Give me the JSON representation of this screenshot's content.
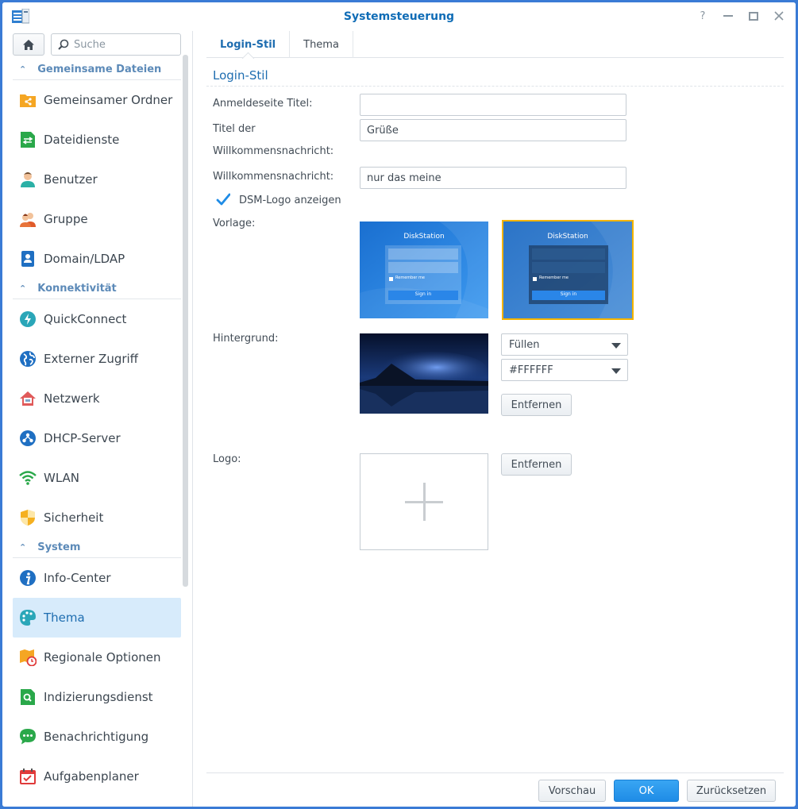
{
  "window": {
    "title": "Systemsteuerung"
  },
  "sidebar": {
    "search_placeholder": "Suche",
    "sections": [
      {
        "label": "Gemeinsame Dateien"
      },
      {
        "label": "Konnektivität"
      },
      {
        "label": "System"
      }
    ],
    "items": [
      {
        "label": "Gemeinsamer Ordner",
        "icon": "shared-folder-icon"
      },
      {
        "label": "Dateidienste",
        "icon": "file-services-icon"
      },
      {
        "label": "Benutzer",
        "icon": "user-icon"
      },
      {
        "label": "Gruppe",
        "icon": "group-icon"
      },
      {
        "label": "Domain/LDAP",
        "icon": "domain-icon"
      },
      {
        "label": "QuickConnect",
        "icon": "quickconnect-icon"
      },
      {
        "label": "Externer Zugriff",
        "icon": "globe-icon"
      },
      {
        "label": "Netzwerk",
        "icon": "network-house-icon"
      },
      {
        "label": "DHCP-Server",
        "icon": "dhcp-icon"
      },
      {
        "label": "WLAN",
        "icon": "wifi-icon"
      },
      {
        "label": "Sicherheit",
        "icon": "shield-icon"
      },
      {
        "label": "Info-Center",
        "icon": "info-icon"
      },
      {
        "label": "Thema",
        "icon": "palette-icon",
        "active": true
      },
      {
        "label": "Regionale Optionen",
        "icon": "regional-icon"
      },
      {
        "label": "Indizierungsdienst",
        "icon": "index-icon"
      },
      {
        "label": "Benachrichtigung",
        "icon": "chat-icon"
      },
      {
        "label": "Aufgabenplaner",
        "icon": "calendar-icon"
      }
    ]
  },
  "tabs": [
    {
      "label": "Login-Stil",
      "active": true
    },
    {
      "label": "Thema"
    }
  ],
  "form": {
    "section_title": "Login-Stil",
    "login_title_label": "Anmeldeseite Titel:",
    "login_title_value": "",
    "welcome_title_label_1": "Titel der",
    "welcome_title_label_2": "Willkommensnachricht:",
    "welcome_title_value": "Grüße",
    "welcome_msg_label": "Willkommensnachricht:",
    "welcome_msg_value": "nur das meine",
    "show_logo_label": "DSM-Logo anzeigen",
    "show_logo_checked": true,
    "template_label": "Vorlage:",
    "template_1_title": "DiskStation",
    "template_2_title": "DiskStation",
    "remember_me": "Remember me",
    "sign_in": "Sign in",
    "background_label": "Hintergrund:",
    "background_fill": "Füllen",
    "background_color": "#FFFFFF",
    "background_remove": "Entfernen",
    "logo_label": "Logo:",
    "logo_remove": "Entfernen"
  },
  "footer": {
    "preview": "Vorschau",
    "ok": "OK",
    "reset": "Zurücksetzen"
  },
  "colors": {
    "accent": "#1e6db0",
    "selected_template_border": "#f4b400",
    "active_nav_bg": "#d7ebfb"
  }
}
